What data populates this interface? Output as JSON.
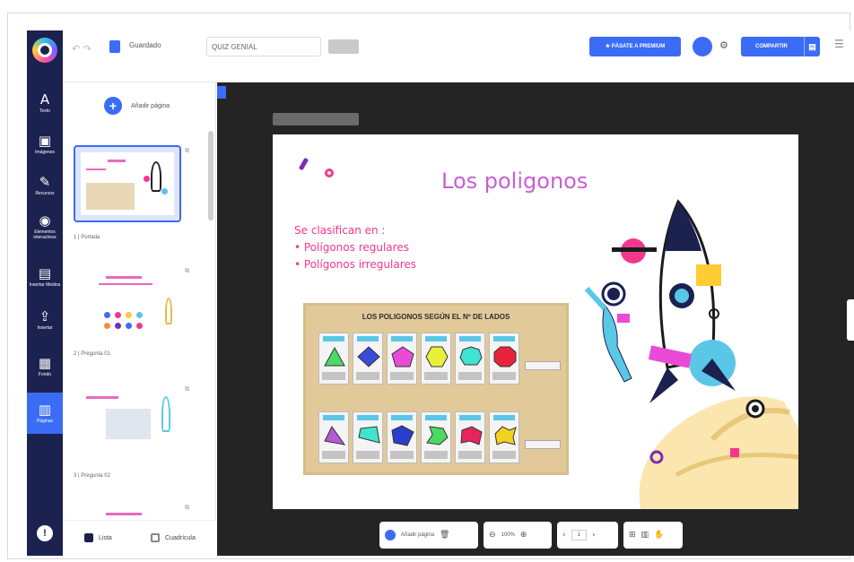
{
  "rail": {
    "items": [
      {
        "label": "Texto",
        "icon": "A"
      },
      {
        "label": "Imágenes",
        "icon": "▣"
      },
      {
        "label": "Recursos",
        "icon": "✎"
      },
      {
        "label": "Elementos interactivos",
        "icon": "◉"
      },
      {
        "label": "Insertar Medios",
        "icon": "▤"
      },
      {
        "label": "Insertar",
        "icon": "⇪"
      },
      {
        "label": "Fondo",
        "icon": "▦"
      },
      {
        "label": "Páginas",
        "icon": "▥"
      }
    ],
    "help_icon": "!"
  },
  "topbar": {
    "saved_label": "Guardado",
    "title_value": "QUIZ GENIAL",
    "tag_label": "",
    "premium_label": "PÁSATE A PREMIUM",
    "user_initial": "",
    "share_label": "COMPARTIR"
  },
  "pages_panel": {
    "add_page_label": "Añadir página",
    "thumbnails": [
      {
        "label": "1 | Portada"
      },
      {
        "label": "2 | Pregunta 01"
      },
      {
        "label": "3 | Pregunta 02"
      },
      {
        "label": ""
      }
    ],
    "tab_list": "Lista",
    "tab_grid": "Cuadrícula"
  },
  "slide": {
    "page_label": "",
    "title": "Los poligonos",
    "intro": "Se clasifican en :",
    "bullets": [
      "Polígonos regulares",
      "Polígonos irregulares"
    ],
    "board_title": "LOS POLIGONOS SEGÚN EL Nº DE LADOS"
  },
  "bottombar": {
    "add_page": "Añadir página",
    "zoom": "100%",
    "page_number": "1"
  },
  "colors": {
    "accent": "#3b6cf6",
    "rail_bg": "#1b2250",
    "title_purple": "#c95fd3",
    "pink": "#f4378e"
  }
}
